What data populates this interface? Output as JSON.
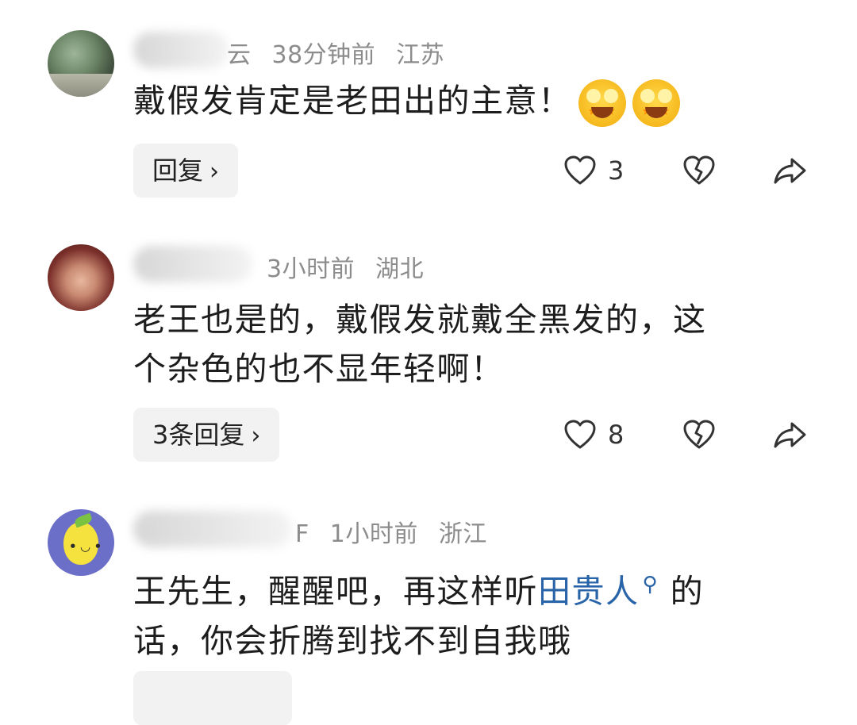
{
  "comments": [
    {
      "name_partial": "云",
      "time": "38分钟前",
      "location": "江苏",
      "text_lines": [
        "戴假发肯定是老田出的主意！"
      ],
      "emoji": "star-eyes-emoji",
      "reply_label": "回复",
      "likes": "3"
    },
    {
      "time": "3小时前",
      "location": "湖北",
      "text_lines": [
        "老王也是的，戴假发就戴全黑发的，这",
        "个杂色的也不显年轻啊！"
      ],
      "reply_label": "3条回复",
      "likes": "8"
    },
    {
      "name_partial": "F",
      "time": "1小时前",
      "location": "浙江",
      "text_line1_before": "王先生，醒醒吧，再这样听",
      "text_link": "田贵人",
      "text_line1_after": " 的",
      "text_line2": "话，你会折腾到找不到自我哦"
    }
  ],
  "icons": [
    "heart-icon",
    "dislike-heart-icon",
    "share-icon",
    "search-icon"
  ],
  "colors": {
    "link": "#2a64a8",
    "meta": "#8c8c8c",
    "button_bg": "#f2f2f2"
  }
}
